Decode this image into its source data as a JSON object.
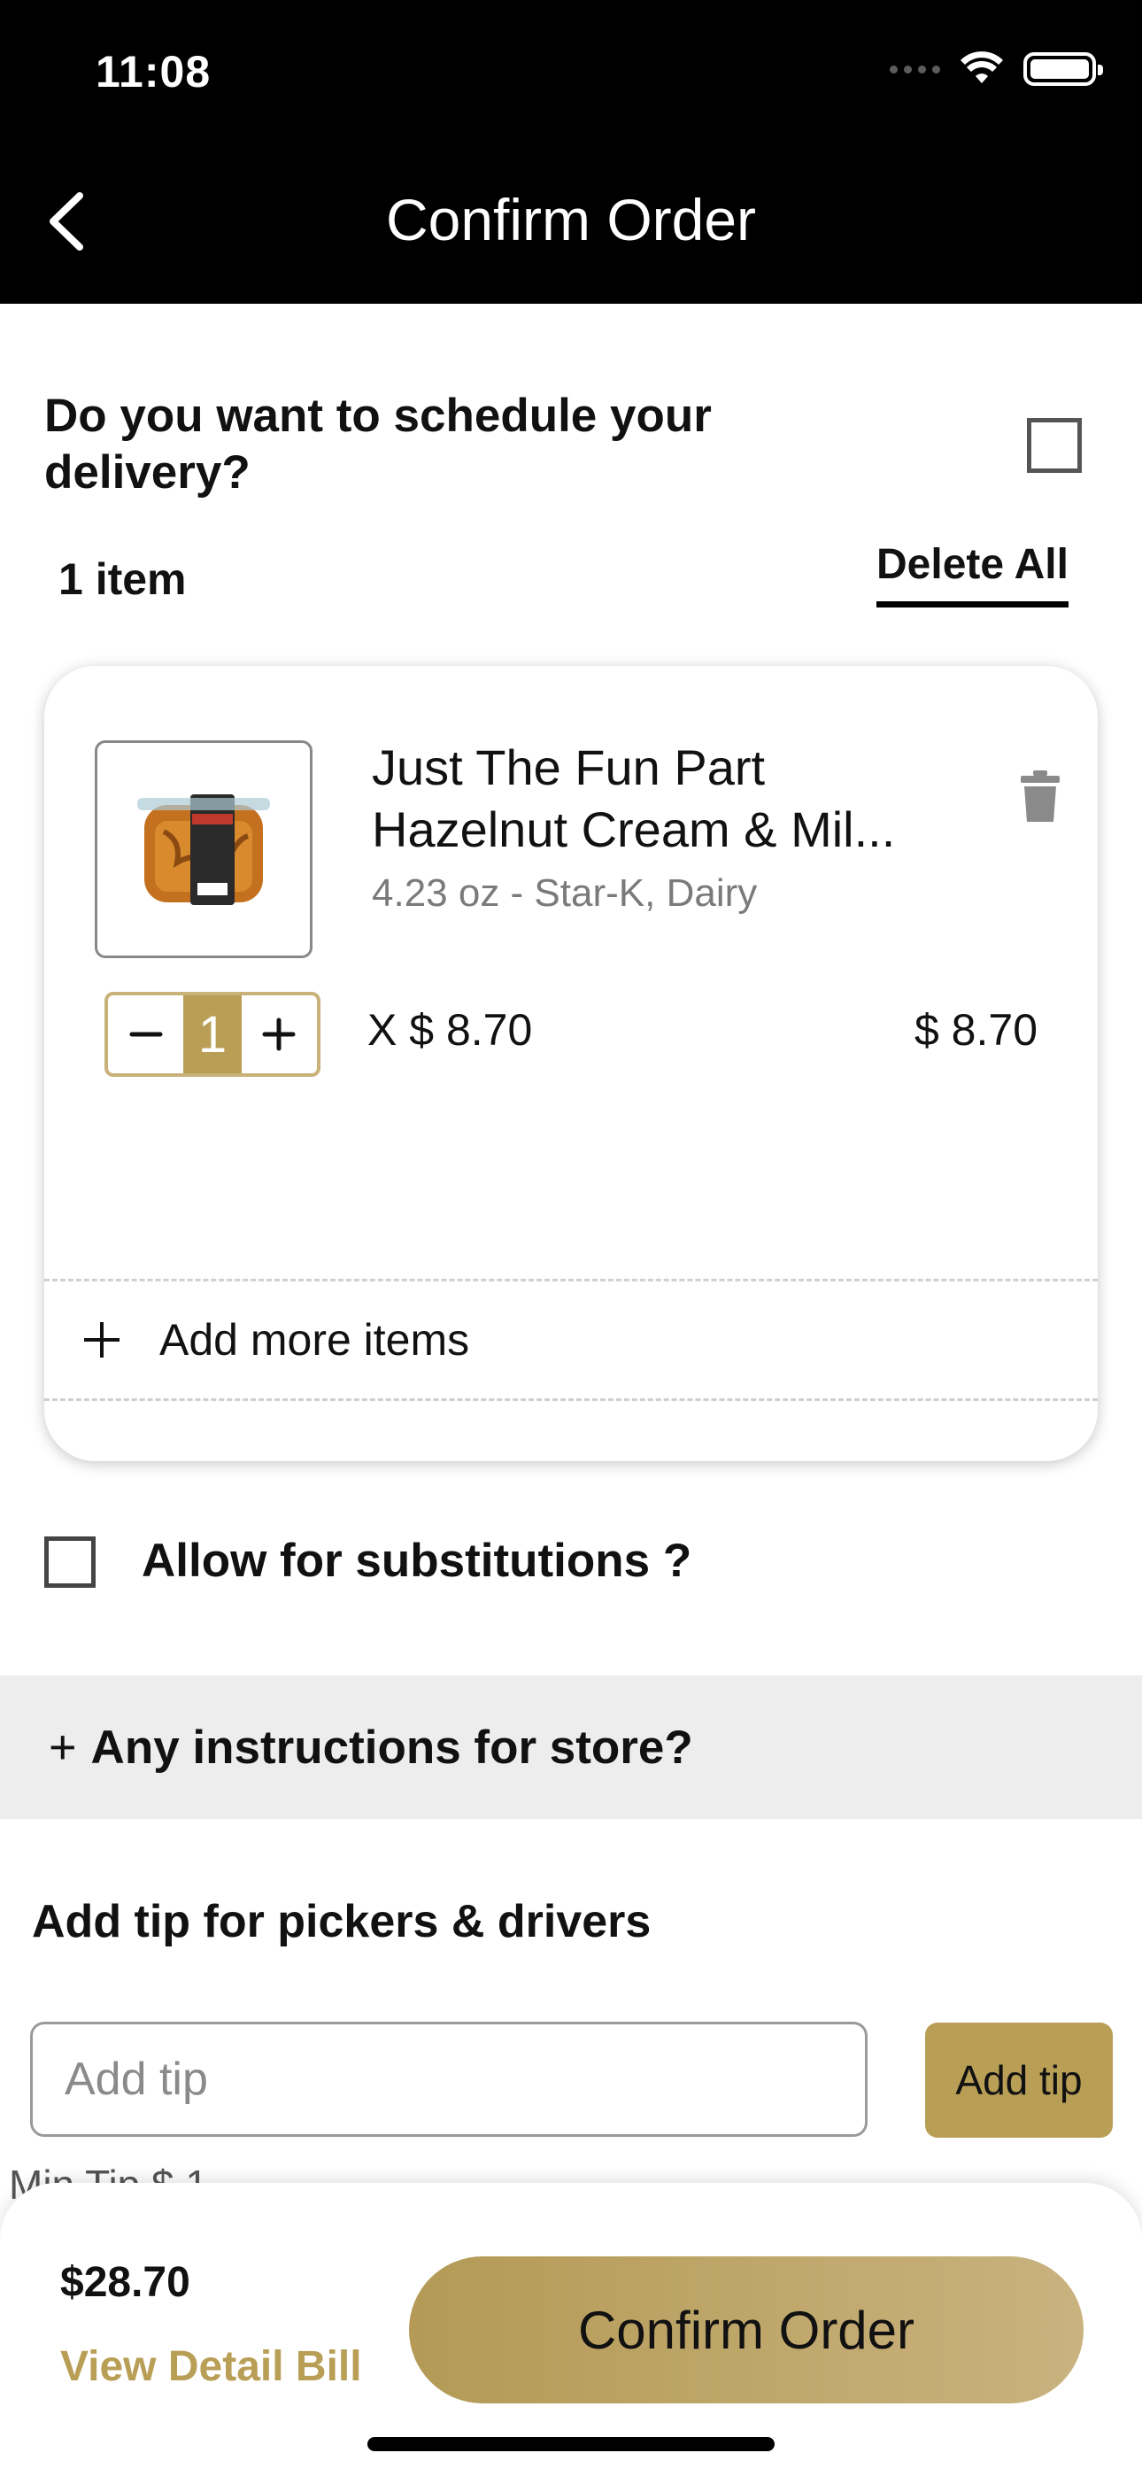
{
  "status_bar": {
    "time": "11:08"
  },
  "nav": {
    "title": "Confirm Order"
  },
  "schedule": {
    "question": "Do you want to schedule your delivery?",
    "checked": false
  },
  "cart": {
    "item_count": "1 item",
    "delete_all_label": "Delete All",
    "items": [
      {
        "name_line1": "Just The Fun Part",
        "name_line2": "Hazelnut Cream & Mil...",
        "meta": "4.23 oz - Star-K, Dairy",
        "quantity": "1",
        "unit_price": "X $ 8.70",
        "line_total": "$ 8.70"
      }
    ],
    "add_more_label": "Add more items"
  },
  "substitutions": {
    "label": "Allow for substitutions ?",
    "checked": false
  },
  "instructions": {
    "plus": "+",
    "label": "Any instructions for store?"
  },
  "tip": {
    "heading": "Add tip for pickers & drivers",
    "input_placeholder": "Add tip",
    "input_value": "",
    "button_label": "Add tip",
    "min_tip_note": "Min Tip $ 1"
  },
  "footer": {
    "total": "$28.70",
    "view_bill_label": "View Detail Bill",
    "confirm_label": "Confirm Order"
  },
  "colors": {
    "accent": "#b99e56",
    "topbar": "#000000",
    "instructions_bg": "#ededed"
  }
}
